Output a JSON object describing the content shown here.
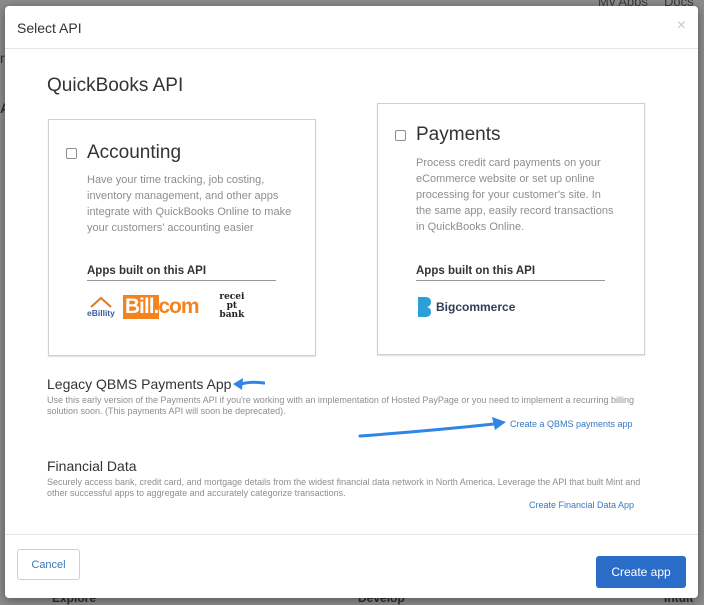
{
  "background": {
    "top_links": [
      "My Apps",
      "Docs"
    ],
    "bottom_links": [
      "Explore",
      "Develop",
      "Intuit"
    ]
  },
  "modal": {
    "title": "Select API",
    "close_glyph": "×",
    "section_title": "QuickBooks API",
    "cards": [
      {
        "name": "Accounting",
        "description": "Have your time tracking, job costing, inventory management, and other apps integrate with QuickBooks Online to make your customers' accounting easier",
        "built_label": "Apps built on this API",
        "logos": [
          "eBillity",
          "Bill.com",
          "receipt bank"
        ]
      },
      {
        "name": "Payments",
        "description": "Process credit card payments on your eCommerce website or set up online processing for your customer's site. In the same app, easily record transactions in QuickBooks Online.",
        "built_label": "Apps built on this API",
        "logos": [
          "Bigcommerce"
        ]
      }
    ],
    "legacy": {
      "title": "Legacy QBMS Payments App",
      "description": "Use this early version of the Payments API if you're working with an implementation of Hosted PayPage or you need to implement a recurring billing solution soon. (This payments API will soon be deprecated).",
      "link": "Create a QBMS payments app"
    },
    "financial": {
      "title": "Financial Data",
      "description": "Securely access bank, credit card, and mortgage details from the widest financial data network in North America. Leverage the API that built Mint and other successful apps to aggregate and accurately categorize transactions.",
      "link": "Create Financial Data App"
    },
    "footer": {
      "cancel": "Cancel",
      "create": "Create app"
    }
  },
  "colors": {
    "primary": "#2a6dc9",
    "link": "#3779c4",
    "arrow": "#2f86e6"
  }
}
